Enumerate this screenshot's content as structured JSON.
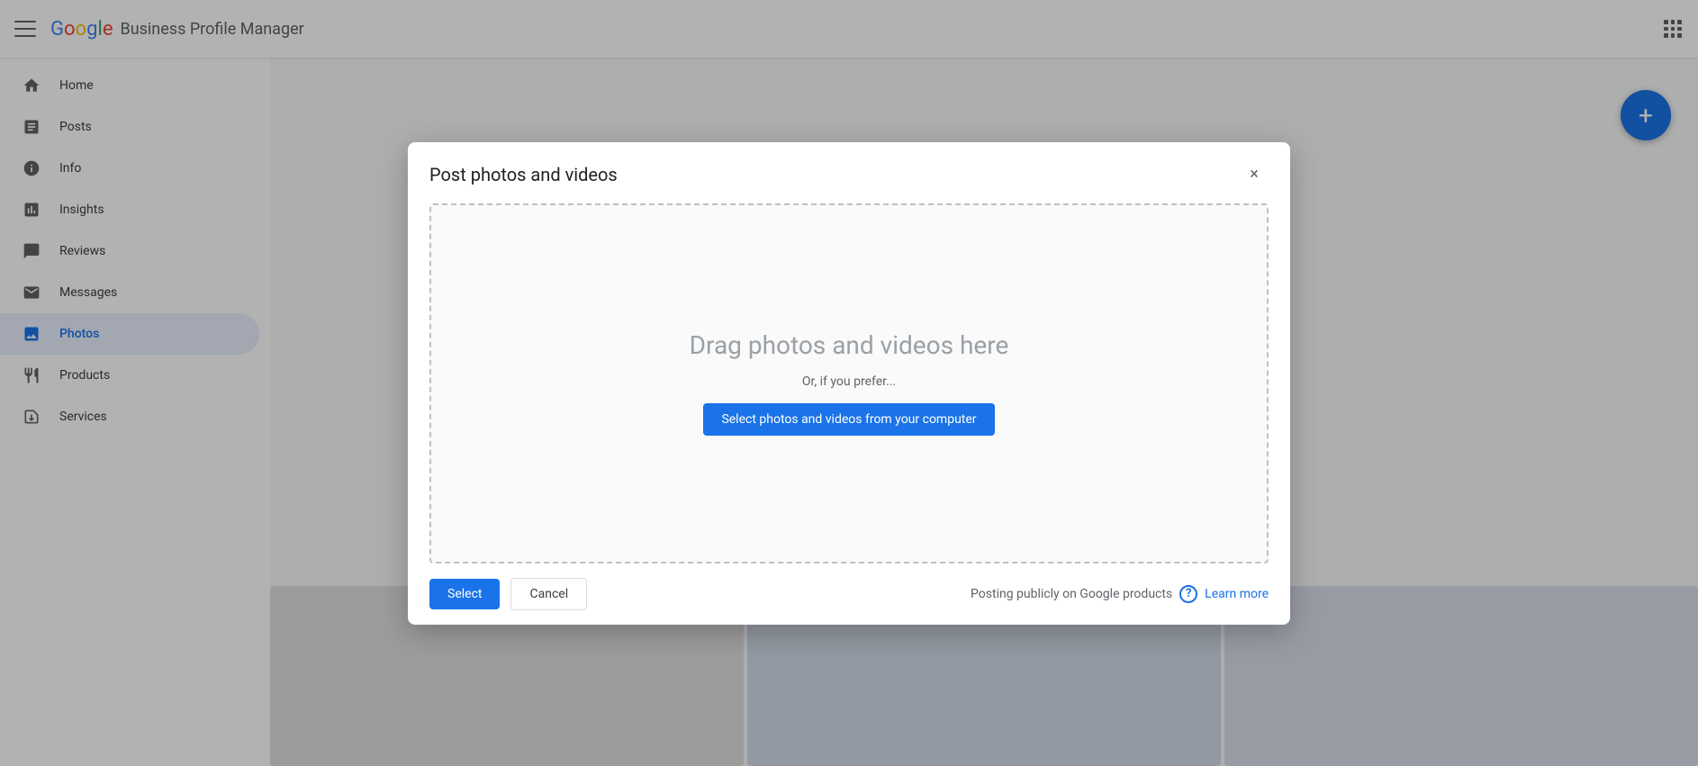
{
  "topbar": {
    "menu_label": "Main menu",
    "logo": {
      "google": "Google",
      "subtitle": "Business Profile Manager"
    },
    "grid_label": "Apps"
  },
  "sidebar": {
    "items": [
      {
        "id": "home",
        "label": "Home",
        "icon": "home-icon"
      },
      {
        "id": "posts",
        "label": "Posts",
        "icon": "posts-icon"
      },
      {
        "id": "info",
        "label": "Info",
        "icon": "info-icon"
      },
      {
        "id": "insights",
        "label": "Insights",
        "icon": "insights-icon"
      },
      {
        "id": "reviews",
        "label": "Reviews",
        "icon": "reviews-icon"
      },
      {
        "id": "messages",
        "label": "Messages",
        "icon": "messages-icon"
      },
      {
        "id": "photos",
        "label": "Photos",
        "icon": "photos-icon",
        "active": true
      },
      {
        "id": "products",
        "label": "Products",
        "icon": "products-icon"
      },
      {
        "id": "services",
        "label": "Services",
        "icon": "services-icon"
      }
    ]
  },
  "fab": {
    "label": "+"
  },
  "modal": {
    "title": "Post photos and videos",
    "close_label": "×",
    "dropzone": {
      "title": "Drag photos and videos here",
      "subtitle": "Or, if you prefer...",
      "select_btn": "Select photos and videos from your computer"
    },
    "footer": {
      "select_btn": "Select",
      "cancel_btn": "Cancel",
      "posting_info": "Posting publicly on Google products",
      "learn_more": "Learn more"
    }
  }
}
